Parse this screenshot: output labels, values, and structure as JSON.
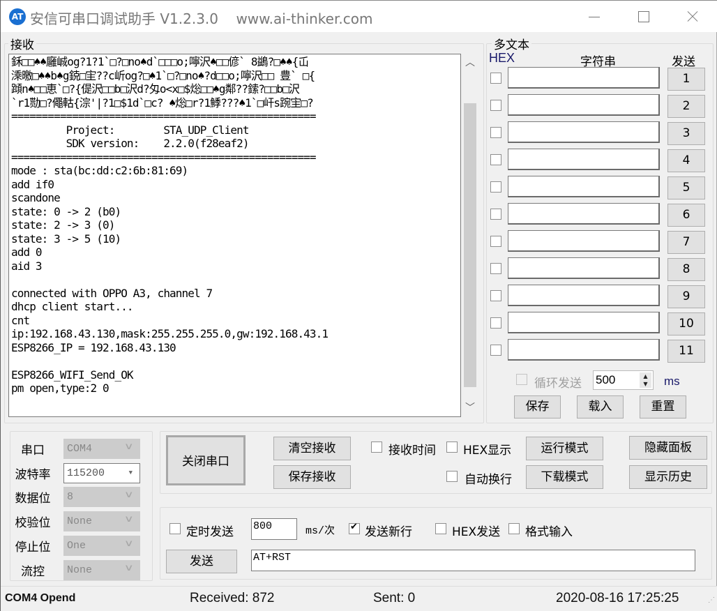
{
  "window": {
    "app_icon": "ai-thinker-logo-icon",
    "title": "安信可串口调试助手 V1.2.3.0    www.ai-thinker.com",
    "controls": [
      "minimize-icon",
      "maximize-icon",
      "close-icon"
    ]
  },
  "receive": {
    "group_label": "接收",
    "lines": [
      "鉌□□♠♠廱峸og?1?1`□?□no♠d`□□□o;嚀沢♠□□偐` 8鷁?□♠♠{屲",
      "溗曒□♠♠b♠g鋴□宔??c岓og?□♠1`□?□no♠?d□□o;嚀沢□□ 豊` □{",
      "蹞n♠□□恵`□?{偍沢□□b□沢d?匁o<x□$焧□□♠g鄰??鎍?□□b□沢",
      "`r1勚□?僶軲{淙'|?1□$1d`□c? ♠焧□r?1鯚???♠1`□屽s踠宔□?",
      "==================================================",
      "         Project:        STA_UDP_Client",
      "         SDK version:    2.2.0(f28eaf2)",
      "==================================================",
      "mode : sta(bc:dd:c2:6b:81:69)",
      "add if0",
      "scandone",
      "state: 0 -> 2 (b0)",
      "state: 2 -> 3 (0)",
      "state: 3 -> 5 (10)",
      "add 0",
      "aid 3",
      "",
      "connected with OPPO A3, channel 7",
      "dhcp client start...",
      "cnt",
      "ip:192.168.43.130,mask:255.255.255.0,gw:192.168.43.1",
      "ESP8266_IP = 192.168.43.130",
      "",
      "ESP8266_WIFI_Send_OK",
      "pm open,type:2 0"
    ],
    "scroll_up_icon": "chevron-up-icon",
    "scroll_down_icon": "chevron-down-icon"
  },
  "multitext": {
    "group_label": "多文本",
    "col_hex": "HEX",
    "col_string": "字符串",
    "col_send": "发送",
    "rows": [
      {
        "hex": false,
        "value": "",
        "button": "1"
      },
      {
        "hex": false,
        "value": "",
        "button": "2"
      },
      {
        "hex": false,
        "value": "",
        "button": "3"
      },
      {
        "hex": false,
        "value": "",
        "button": "4"
      },
      {
        "hex": false,
        "value": "",
        "button": "5"
      },
      {
        "hex": false,
        "value": "",
        "button": "6"
      },
      {
        "hex": false,
        "value": "",
        "button": "7"
      },
      {
        "hex": false,
        "value": "",
        "button": "8"
      },
      {
        "hex": false,
        "value": "",
        "button": "9"
      },
      {
        "hex": false,
        "value": "",
        "button": "10"
      },
      {
        "hex": false,
        "value": "",
        "button": "11"
      }
    ],
    "loop_send_label": "循环发送",
    "loop_interval": "500",
    "loop_unit": "ms",
    "save_label": "保存",
    "load_label": "载入",
    "reset_label": "重置"
  },
  "port": {
    "fields": [
      {
        "label": "串口",
        "value": "COM4",
        "enabled": false
      },
      {
        "label": "波特率",
        "value": "115200",
        "enabled": true
      },
      {
        "label": "数据位",
        "value": "8",
        "enabled": false
      },
      {
        "label": "校验位",
        "value": "None",
        "enabled": false
      },
      {
        "label": "停止位",
        "value": "One",
        "enabled": false
      },
      {
        "label": "流控",
        "value": "None",
        "enabled": false
      }
    ]
  },
  "controls": {
    "close_port": "关闭串口",
    "clear_receive": "清空接收",
    "save_receive": "保存接收",
    "receive_time": {
      "label": "接收时间",
      "checked": false
    },
    "hex_display": {
      "label": "HEX显示",
      "checked": false
    },
    "auto_wrap": {
      "label": "自动换行",
      "checked": false
    },
    "run_mode": "运行模式",
    "download_mode": "下载模式",
    "hide_panel": "隐藏面板",
    "show_history": "显示历史"
  },
  "send": {
    "timed_send": {
      "label": "定时发送",
      "checked": false
    },
    "interval": "800",
    "interval_unit": "ms/次",
    "send_newline": {
      "label": "发送新行",
      "checked": true
    },
    "hex_send": {
      "label": "HEX发送",
      "checked": false
    },
    "format_input": {
      "label": "格式输入",
      "checked": false
    },
    "send_button": "发送",
    "input_value": "AT+RST"
  },
  "status": {
    "port_state": "COM4 Opend",
    "received": "Received: 872",
    "sent": "Sent: 0",
    "datetime": "2020-08-16 17:25:25"
  }
}
